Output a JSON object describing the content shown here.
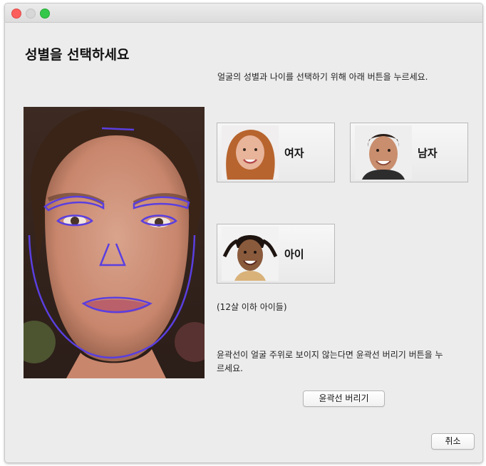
{
  "window": {
    "controls": [
      "close",
      "minimize",
      "maximize"
    ]
  },
  "title": "성별을 선택하세요",
  "instruction": "얼굴의 성별과 나이를 선택하기 위해 아래 버튼을 누르세요.",
  "choices": {
    "female": "여자",
    "male": "남자",
    "child": "아이"
  },
  "child_note": "(12살 이하 아이들)",
  "outline_note": {
    "line1": "윤곽선이 얼굴 주위로 보이지 않는다면 윤곽선 버리기 버튼을 누",
    "line2": "르세요."
  },
  "buttons": {
    "discard_outline": "윤곽선 버리기",
    "cancel": "취소"
  },
  "colors": {
    "outline": "#5a3fe0",
    "window_bg": "#ececec"
  }
}
